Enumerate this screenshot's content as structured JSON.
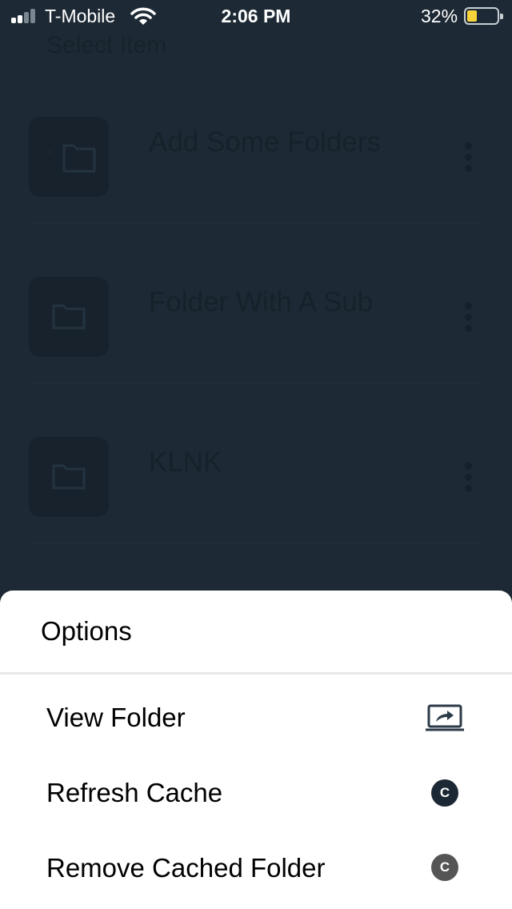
{
  "status_bar": {
    "carrier": "T-Mobile",
    "time": "2:06 PM",
    "battery_percent": "32%"
  },
  "background": {
    "header": "Select Item",
    "folders": [
      {
        "name": "Add Some Folders",
        "icon": "folder-with-chevron-icon"
      },
      {
        "name": "Folder With A Sub",
        "icon": "folder-icon"
      },
      {
        "name": "KLNK",
        "icon": "folder-icon"
      }
    ]
  },
  "sheet": {
    "title": "Options",
    "options": [
      {
        "label": "View Folder",
        "icon": "open-external-laptop-icon"
      },
      {
        "label": "Refresh Cache",
        "icon": "cache-c-icon",
        "icon_text": "C",
        "icon_color": "#1c2834"
      },
      {
        "label": "Remove Cached Folder",
        "icon": "cache-c-icon",
        "icon_text": "C",
        "icon_color": "#555555"
      }
    ]
  },
  "colors": {
    "background": "#1d2934",
    "sheet": "#ffffff",
    "battery_fill": "#f5d33a"
  }
}
